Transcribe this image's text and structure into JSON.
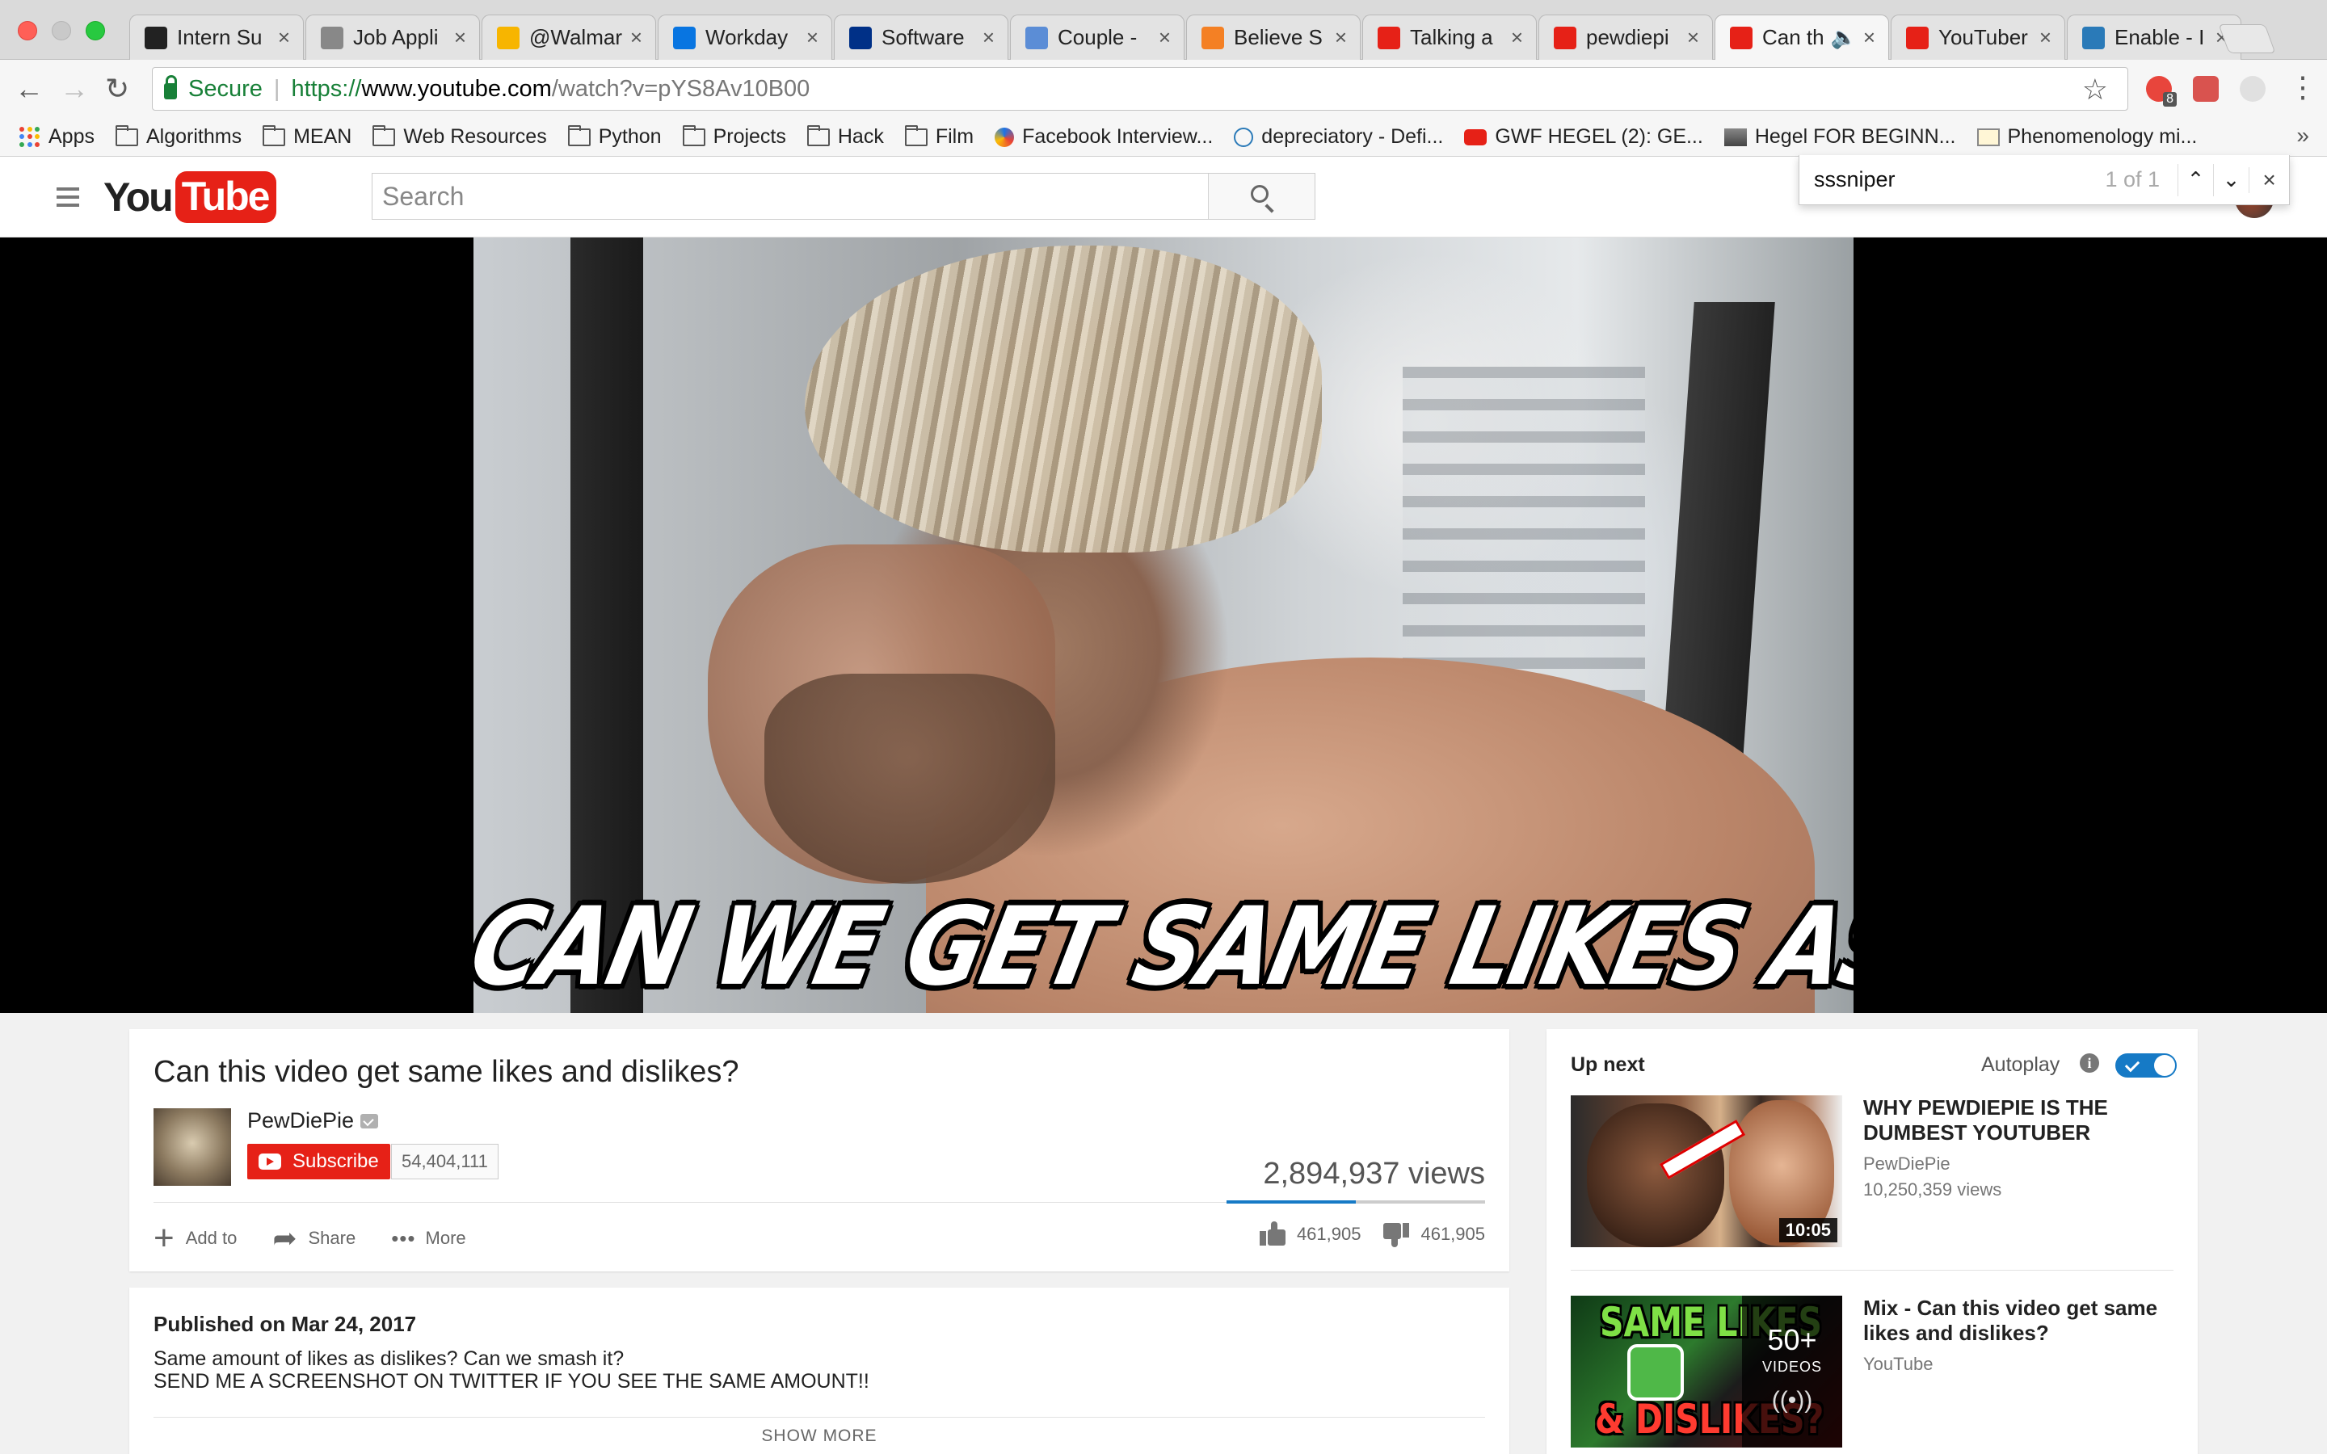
{
  "browser": {
    "tabs": [
      {
        "title": "Intern Su",
        "favicon": "github-icon",
        "color": "#222222"
      },
      {
        "title": "Job Appli",
        "favicon": "document-icon",
        "color": "#888888"
      },
      {
        "title": "@Walmar",
        "favicon": "walmart-icon",
        "color": "#f7b500"
      },
      {
        "title": "Workday",
        "favicon": "workday-icon",
        "color": "#0875e1"
      },
      {
        "title": "Software",
        "favicon": "paypal-icon",
        "color": "#003087"
      },
      {
        "title": "Couple -",
        "favicon": "chat-bubble-icon",
        "color": "#5b8dd6"
      },
      {
        "title": "Believe S",
        "favicon": "stack-icon",
        "color": "#f48024"
      },
      {
        "title": "Talking a",
        "favicon": "youtube-icon",
        "color": "#e62117"
      },
      {
        "title": "pewdiepi",
        "favicon": "youtube-icon",
        "color": "#e62117"
      },
      {
        "title": "Can th",
        "favicon": "youtube-icon",
        "color": "#e62117",
        "active": true,
        "audio": true
      },
      {
        "title": "YouTuber",
        "favicon": "youtube-icon",
        "color": "#e62117"
      },
      {
        "title": "Enable - I",
        "favicon": "globe-icon",
        "color": "#2a7ab8"
      }
    ],
    "close_glyph": "×",
    "audio_glyph": "🔈",
    "secure_label": "Secure",
    "url_scheme": "https://",
    "url_host": "www.youtube.com",
    "url_path": "/watch?v=pYS8Av10B00",
    "extension_badge": "8"
  },
  "bookmarks": [
    {
      "label": "Apps",
      "icon": "apps-grid-icon"
    },
    {
      "label": "Algorithms",
      "icon": "folder-icon"
    },
    {
      "label": "MEAN",
      "icon": "folder-icon"
    },
    {
      "label": "Web Resources",
      "icon": "folder-icon"
    },
    {
      "label": "Python",
      "icon": "folder-icon"
    },
    {
      "label": "Projects",
      "icon": "folder-icon"
    },
    {
      "label": "Hack",
      "icon": "folder-icon"
    },
    {
      "label": "Film",
      "icon": "folder-icon"
    },
    {
      "label": "Facebook Interview...",
      "icon": "swirl-icon"
    },
    {
      "label": "depreciatory - Defi...",
      "icon": "globe-icon"
    },
    {
      "label": "GWF HEGEL (2): GE...",
      "icon": "youtube-icon"
    },
    {
      "label": "Hegel FOR BEGINN...",
      "icon": "image-icon"
    },
    {
      "label": "Phenomenology mi...",
      "icon": "page-icon"
    }
  ],
  "bookmarks_overflow": "»",
  "youtube": {
    "logo_you": "You",
    "logo_tube": "Tube",
    "search_placeholder": "Search"
  },
  "find_bar": {
    "query": "sssniper",
    "count": "1 of 1",
    "up_glyph": "⌃",
    "down_glyph": "⌄",
    "close_glyph": "×"
  },
  "player": {
    "caption": "CAN WE GET SAME LIKES AS DISLIKES!?"
  },
  "video": {
    "title": "Can this video get same likes and dislikes?",
    "channel": "PewDiePie",
    "subscribe_label": "Subscribe",
    "subscriber_count": "54,404,111",
    "views": "2,894,937 views",
    "add_to_label": "Add to",
    "share_label": "Share",
    "more_label": "More",
    "likes": "461,905",
    "dislikes": "461,905",
    "like_ratio": 0.5
  },
  "description": {
    "published": "Published on Mar 24, 2017",
    "line1": "Same amount of likes as dislikes? Can we smash it?",
    "line2": "SEND ME A SCREENSHOT ON TWITTER IF YOU SEE THE SAME AMOUNT!!",
    "show_more": "SHOW MORE"
  },
  "sidebar": {
    "up_next": "Up next",
    "autoplay_label": "Autoplay",
    "autoplay_on": true,
    "info_glyph": "i",
    "items": [
      {
        "title": "WHY PEWDIEPIE IS THE DUMBEST YOUTUBER",
        "channel": "PewDiePie",
        "views": "10,250,359 views",
        "duration": "10:05"
      },
      {
        "title": "Mix - Can this video get same likes and dislikes?",
        "channel": "YouTube",
        "mix_count": "50+",
        "mix_label": "VIDEOS",
        "thumb_top": "SAME LIKES",
        "thumb_bottom": "& DISLIKES?"
      }
    ]
  }
}
